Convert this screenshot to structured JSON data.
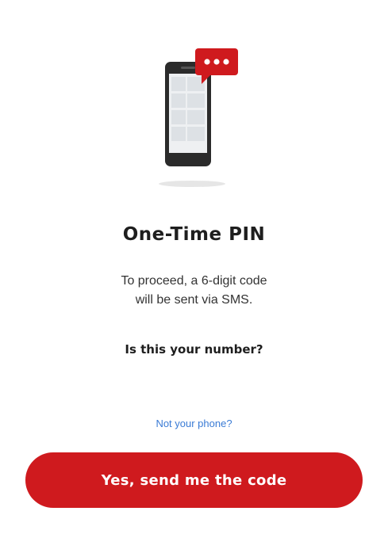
{
  "otp": {
    "title": "One-Time PIN",
    "body": "To proceed, a 6-digit code\nwill be sent via SMS.",
    "question": "Is this your number?",
    "not_your_phone_link": "Not your phone?",
    "send_button_label": "Yes, send me the code"
  },
  "illustration": {
    "icon": "phone-sms-icon",
    "bubble_icon": "chat-bubble-icon"
  },
  "colors": {
    "accent": "#cf1a1e",
    "link": "#3a7bd5",
    "phone_body": "#2b2b2b",
    "background": "#ffffff"
  }
}
